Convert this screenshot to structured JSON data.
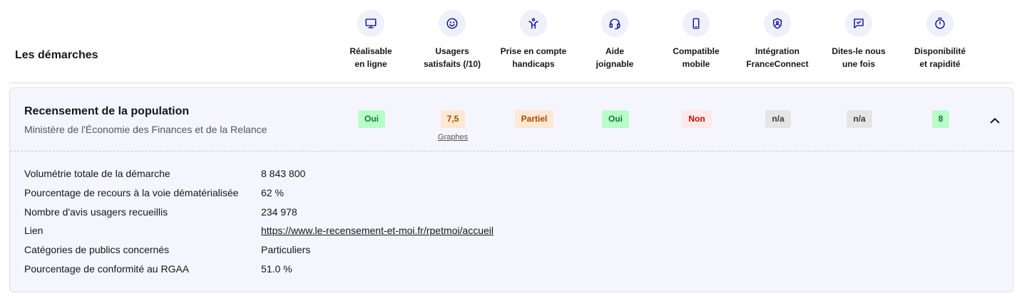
{
  "header": {
    "title": "Les démarches",
    "columns": [
      {
        "icon": "monitor-icon",
        "label": "Réalisable\nen ligne"
      },
      {
        "icon": "smiley-icon",
        "label": "Usagers\nsatisfaits (/10)"
      },
      {
        "icon": "accessibility-icon",
        "label": "Prise en compte\nhandicaps"
      },
      {
        "icon": "headset-icon",
        "label": "Aide\njoignable"
      },
      {
        "icon": "smartphone-icon",
        "label": "Compatible\nmobile"
      },
      {
        "icon": "shield-user-icon",
        "label": "Intégration\nFranceConnect"
      },
      {
        "icon": "chat-check-icon",
        "label": "Dites-le nous\nune fois"
      },
      {
        "icon": "timer-icon",
        "label": "Disponibilité\net rapidité"
      }
    ]
  },
  "procedure": {
    "title": "Recensement de la population",
    "ministry": "Ministère de l'Économie des Finances et de la Relance",
    "indicators": [
      {
        "value": "Oui",
        "color": "#b8fec9"
      },
      {
        "value": "7,5",
        "color": "#fee9e5",
        "link": "Graphes"
      },
      {
        "value": "Partiel",
        "color": "#fde8d4"
      },
      {
        "value": "Oui",
        "color": "#b8fec9"
      },
      {
        "value": "Non",
        "color": "#ffe9e9"
      },
      {
        "value": "n/a",
        "color": "#e5e5e5"
      },
      {
        "value": "n/a",
        "color": "#e5e5e5"
      },
      {
        "value": "8",
        "color": "#b8fec9"
      }
    ],
    "toggle_icon": "chevron-up-icon",
    "details": [
      {
        "label": "Volumétrie totale de la démarche",
        "value": "8 843 800"
      },
      {
        "label": "Pourcentage de recours à la voie dématérialisée",
        "value": "62 %"
      },
      {
        "label": "Nombre d'avis usagers recueillis",
        "value": "234 978"
      },
      {
        "label": "Lien",
        "value": "https://www.le-recensement-et-moi.fr/rpetmoi/accueil"
      },
      {
        "label": "Catégories de publics concernés",
        "value": "Particuliers"
      },
      {
        "label": "Pourcentage de conformité au RGAA",
        "value": "51.0 %"
      }
    ]
  }
}
